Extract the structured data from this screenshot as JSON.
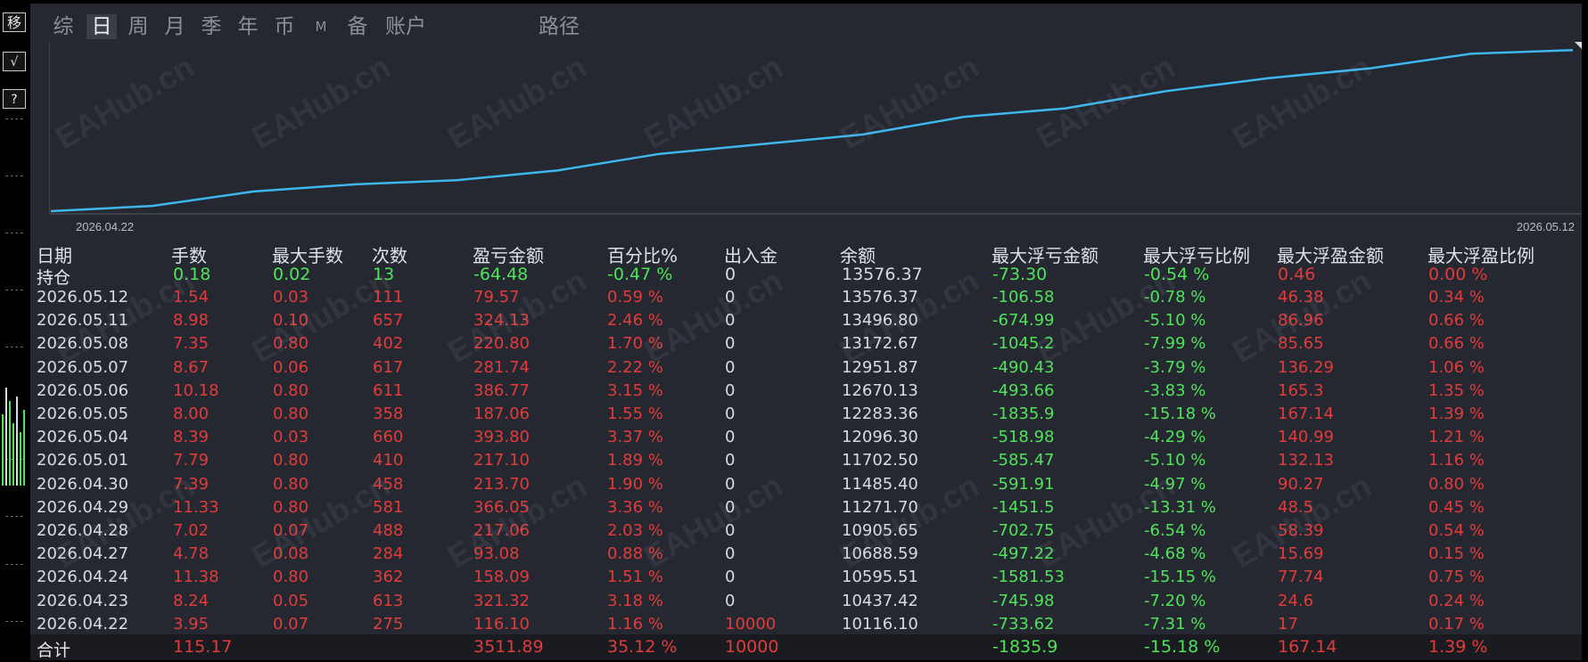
{
  "left_toolbar": {
    "move_label": "移",
    "check_label": "√",
    "help_label": "?"
  },
  "tabs": [
    {
      "label": "综",
      "active": false
    },
    {
      "label": "日",
      "active": true
    },
    {
      "label": "周",
      "active": false
    },
    {
      "label": "月",
      "active": false
    },
    {
      "label": "季",
      "active": false
    },
    {
      "label": "年",
      "active": false
    },
    {
      "label": "币",
      "active": false
    },
    {
      "label": "M",
      "active": false
    },
    {
      "label": "备",
      "active": false
    },
    {
      "label": "账户",
      "active": false
    },
    {
      "label": "路径",
      "active": false
    }
  ],
  "watermark": "EAHub.cn",
  "colors": {
    "line": "#3fb6ee",
    "profit": "#e23b3b",
    "loss": "#4fe35a",
    "neutral": "#d8dbe0",
    "background": "#252830"
  },
  "chart_data": {
    "type": "line",
    "x_start_label": "2026.04.22",
    "x_end_label": "2026.05.12",
    "x": [
      "2026.04.22",
      "2026.04.23",
      "2026.04.24",
      "2026.04.27",
      "2026.04.28",
      "2026.04.29",
      "2026.04.30",
      "2026.05.01",
      "2026.05.04",
      "2026.05.05",
      "2026.05.06",
      "2026.05.07",
      "2026.05.08",
      "2026.05.11",
      "2026.05.12"
    ],
    "values": [
      10116.1,
      10437.42,
      10595.51,
      10688.59,
      10905.65,
      11271.7,
      11485.4,
      11702.5,
      12096.3,
      12283.36,
      12670.13,
      12951.87,
      13172.67,
      13496.8,
      13576.37
    ],
    "ylim": [
      10000,
      13700
    ]
  },
  "table": {
    "headers": [
      "日期",
      "手数",
      "最大手数",
      "次数",
      "盈亏金额",
      "百分比%",
      "出入金",
      "余额",
      "最大浮亏金额",
      "最大浮亏比例",
      "最大浮盈金额",
      "最大浮盈比例"
    ],
    "holding": {
      "label": "持仓",
      "lots": "0.18",
      "max_lots": "0.02",
      "count": "13",
      "pnl": "-64.48",
      "pct": "-0.47 %",
      "deposit": "0",
      "balance": "13576.37",
      "max_dd": "-73.30",
      "max_dd_pct": "-0.54 %",
      "max_fp": "0.46",
      "max_fp_pct": "0.00 %"
    },
    "rows": [
      {
        "date": "2026.05.12",
        "lots": "1.54",
        "max_lots": "0.03",
        "count": "111",
        "pnl": "79.57",
        "pct": "0.59 %",
        "deposit": "0",
        "balance": "13576.37",
        "max_dd": "-106.58",
        "max_dd_pct": "-0.78 %",
        "max_fp": "46.38",
        "max_fp_pct": "0.34 %"
      },
      {
        "date": "2026.05.11",
        "lots": "8.98",
        "max_lots": "0.10",
        "count": "657",
        "pnl": "324.13",
        "pct": "2.46 %",
        "deposit": "0",
        "balance": "13496.80",
        "max_dd": "-674.99",
        "max_dd_pct": "-5.10 %",
        "max_fp": "86.96",
        "max_fp_pct": "0.66 %"
      },
      {
        "date": "2026.05.08",
        "lots": "7.35",
        "max_lots": "0.80",
        "count": "402",
        "pnl": "220.80",
        "pct": "1.70 %",
        "deposit": "0",
        "balance": "13172.67",
        "max_dd": "-1045.2",
        "max_dd_pct": "-7.99 %",
        "max_fp": "85.65",
        "max_fp_pct": "0.66 %"
      },
      {
        "date": "2026.05.07",
        "lots": "8.67",
        "max_lots": "0.06",
        "count": "617",
        "pnl": "281.74",
        "pct": "2.22 %",
        "deposit": "0",
        "balance": "12951.87",
        "max_dd": "-490.43",
        "max_dd_pct": "-3.79 %",
        "max_fp": "136.29",
        "max_fp_pct": "1.06 %"
      },
      {
        "date": "2026.05.06",
        "lots": "10.18",
        "max_lots": "0.80",
        "count": "611",
        "pnl": "386.77",
        "pct": "3.15 %",
        "deposit": "0",
        "balance": "12670.13",
        "max_dd": "-493.66",
        "max_dd_pct": "-3.83 %",
        "max_fp": "165.3",
        "max_fp_pct": "1.35 %"
      },
      {
        "date": "2026.05.05",
        "lots": "8.00",
        "max_lots": "0.80",
        "count": "358",
        "pnl": "187.06",
        "pct": "1.55 %",
        "deposit": "0",
        "balance": "12283.36",
        "max_dd": "-1835.9",
        "max_dd_pct": "-15.18 %",
        "max_fp": "167.14",
        "max_fp_pct": "1.39 %"
      },
      {
        "date": "2026.05.04",
        "lots": "8.39",
        "max_lots": "0.03",
        "count": "660",
        "pnl": "393.80",
        "pct": "3.37 %",
        "deposit": "0",
        "balance": "12096.30",
        "max_dd": "-518.98",
        "max_dd_pct": "-4.29 %",
        "max_fp": "140.99",
        "max_fp_pct": "1.21 %"
      },
      {
        "date": "2026.05.01",
        "lots": "7.79",
        "max_lots": "0.80",
        "count": "410",
        "pnl": "217.10",
        "pct": "1.89 %",
        "deposit": "0",
        "balance": "11702.50",
        "max_dd": "-585.47",
        "max_dd_pct": "-5.10 %",
        "max_fp": "132.13",
        "max_fp_pct": "1.16 %"
      },
      {
        "date": "2026.04.30",
        "lots": "7.39",
        "max_lots": "0.80",
        "count": "458",
        "pnl": "213.70",
        "pct": "1.90 %",
        "deposit": "0",
        "balance": "11485.40",
        "max_dd": "-591.91",
        "max_dd_pct": "-4.97 %",
        "max_fp": "90.27",
        "max_fp_pct": "0.80 %"
      },
      {
        "date": "2026.04.29",
        "lots": "11.33",
        "max_lots": "0.80",
        "count": "581",
        "pnl": "366.05",
        "pct": "3.36 %",
        "deposit": "0",
        "balance": "11271.70",
        "max_dd": "-1451.5",
        "max_dd_pct": "-13.31 %",
        "max_fp": "48.5",
        "max_fp_pct": "0.45 %"
      },
      {
        "date": "2026.04.28",
        "lots": "7.02",
        "max_lots": "0.07",
        "count": "488",
        "pnl": "217.06",
        "pct": "2.03 %",
        "deposit": "0",
        "balance": "10905.65",
        "max_dd": "-702.75",
        "max_dd_pct": "-6.54 %",
        "max_fp": "58.39",
        "max_fp_pct": "0.54 %"
      },
      {
        "date": "2026.04.27",
        "lots": "4.78",
        "max_lots": "0.08",
        "count": "284",
        "pnl": "93.08",
        "pct": "0.88 %",
        "deposit": "0",
        "balance": "10688.59",
        "max_dd": "-497.22",
        "max_dd_pct": "-4.68 %",
        "max_fp": "15.69",
        "max_fp_pct": "0.15 %"
      },
      {
        "date": "2026.04.24",
        "lots": "11.38",
        "max_lots": "0.80",
        "count": "362",
        "pnl": "158.09",
        "pct": "1.51 %",
        "deposit": "0",
        "balance": "10595.51",
        "max_dd": "-1581.53",
        "max_dd_pct": "-15.15 %",
        "max_fp": "77.74",
        "max_fp_pct": "0.75 %"
      },
      {
        "date": "2026.04.23",
        "lots": "8.24",
        "max_lots": "0.05",
        "count": "613",
        "pnl": "321.32",
        "pct": "3.18 %",
        "deposit": "0",
        "balance": "10437.42",
        "max_dd": "-745.98",
        "max_dd_pct": "-7.20 %",
        "max_fp": "24.6",
        "max_fp_pct": "0.24 %"
      },
      {
        "date": "2026.04.22",
        "lots": "3.95",
        "max_lots": "0.07",
        "count": "275",
        "pnl": "116.10",
        "pct": "1.16 %",
        "deposit": "10000",
        "balance": "10116.10",
        "max_dd": "-733.62",
        "max_dd_pct": "-7.31 %",
        "max_fp": "17",
        "max_fp_pct": "0.17 %"
      }
    ],
    "total": {
      "label": "合计",
      "lots": "115.17",
      "pnl": "3511.89",
      "pct": "35.12 %",
      "deposit": "10000",
      "max_dd": "-1835.9",
      "max_dd_pct": "-15.18 %",
      "max_fp": "167.14",
      "max_fp_pct": "1.39 %"
    }
  }
}
